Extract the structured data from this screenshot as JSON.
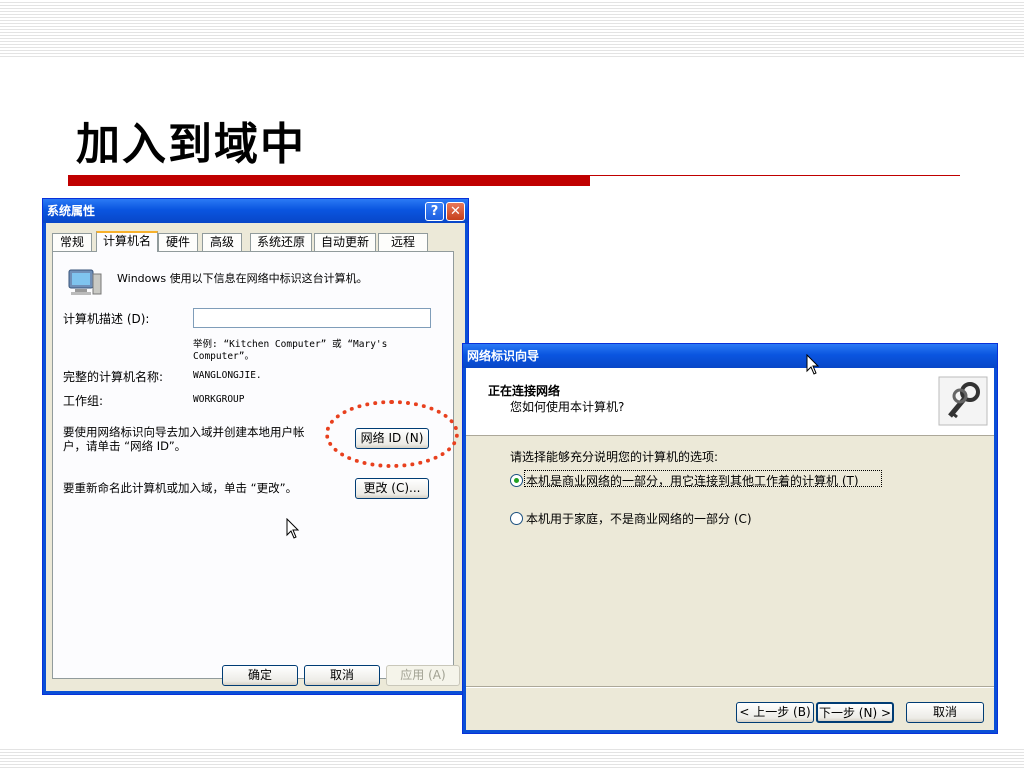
{
  "slide": {
    "title": "加入到域中"
  },
  "system_properties": {
    "title": "系统属性",
    "help_button": "?",
    "close_button": "✕",
    "tabs": [
      "常规",
      "计算机名",
      "硬件",
      "高级",
      "系统还原",
      "自动更新",
      "远程"
    ],
    "active_tab": "计算机名",
    "intro": "Windows 使用以下信息在网络中标识这台计算机。",
    "description_label": "计算机描述 (D):",
    "description_value": "",
    "example_line1": "举例: “Kitchen Computer” 或 “Mary's",
    "example_line2": "Computer”。",
    "full_name_label": "完整的计算机名称:",
    "full_name_value": "WANGLONGJIE.",
    "workgroup_label": "工作组:",
    "workgroup_value": "WORKGROUP",
    "network_id_text_line1": "要使用网络标识向导去加入域并创建本地用户帐",
    "network_id_text_line2": "户，请单击 “网络 ID”。",
    "network_id_button": "网络 ID (N)",
    "rename_text": "要重新命名此计算机或加入域，单击 “更改”。",
    "change_button": "更改 (C)...",
    "ok_button": "确定",
    "cancel_button": "取消",
    "apply_button": "应用 (A)"
  },
  "wizard": {
    "title": "网络标识向导",
    "header_title": "正在连接网络",
    "header_subtitle": "您如何使用本计算机?",
    "prompt": "请选择能够充分说明您的计算机的选项:",
    "options": [
      {
        "label": "本机是商业网络的一部分，用它连接到其他工作着的计算机 (T)",
        "checked": true
      },
      {
        "label": "本机用于家庭，不是商业网络的一部分 (C)",
        "checked": false
      }
    ],
    "back_button": "< 上一步 (B)",
    "next_button": "下一步 (N) >",
    "cancel_button": "取消"
  }
}
